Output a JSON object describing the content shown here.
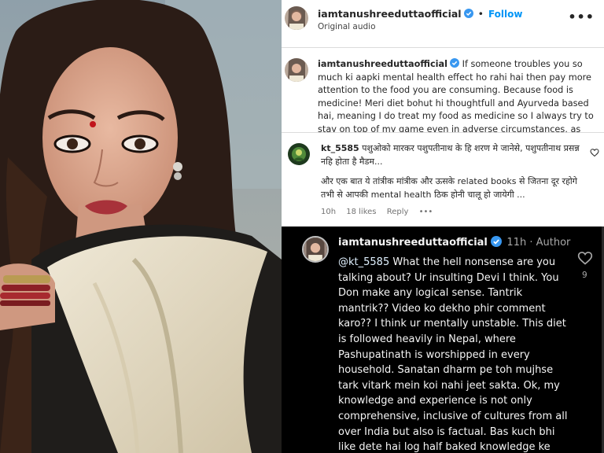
{
  "post": {
    "username": "iamtanushreeduttaofficial",
    "separator": "•",
    "follow_label": "Follow",
    "audio": "Original audio",
    "more_label": "•••"
  },
  "caption": {
    "username": "iamtanushreeduttaofficial",
    "text": "If someone troubles you so much ki aapki mental health effect ho rahi hai then pay more attention to the food you are consuming. Because food is medicine! Meri diet bohut hi thoughtfull and Ayurveda based hai, meaning I do treat my food as medicine so I always try to stay on top of my game even in adverse circumstances, as much as I can ofcourse. I was"
  },
  "comment": {
    "username": "kt_5585",
    "text_line1": "पशुओको मारकर पशुपतीनाथ के हि शरण मे जानेसे, पशुपतीनाथ प्रसन्न नहि होता है मैडम...",
    "text_line2": "और एक बात ये तांत्रीक मांत्रीक और ऊसके related books से जितना दूर रहोगे तभी से आपकी mental health ठिक होनी चालू हो जायेगी ...",
    "time": "10h",
    "likes": "18 likes",
    "reply_label": "Reply",
    "more_label": "•••"
  },
  "reply": {
    "username": "iamtanushreeduttaofficial",
    "time": "11h · Author",
    "mention": "@kt_5585",
    "text": "What the hell nonsense are you talking about? Ur insulting Devi I think. You Don make any logical sense. Tantrik mantrik?? Video ko dekho phir comment karo?? I think ur mentally unstable. This diet is followed heavily in Nepal, where Pashupatinath is worshipped in every household. Sanatan dharm pe toh mujhse tark vitark mein koi nahi jeet sakta. Ok, my knowledge and experience is not only comprehensive, inclusive of cultures from all over India but also is factual. Bas kuch bhi like dete hai log half baked knowledge ke saath. 😂",
    "like_count": "9"
  },
  "colors": {
    "link_blue": "#0095f6",
    "verified_blue": "#3897f0",
    "reply_bg": "#000000",
    "divider": "#dbdbdb"
  },
  "icons": [
    "verified-badge-icon",
    "more-options-icon",
    "heart-icon"
  ]
}
